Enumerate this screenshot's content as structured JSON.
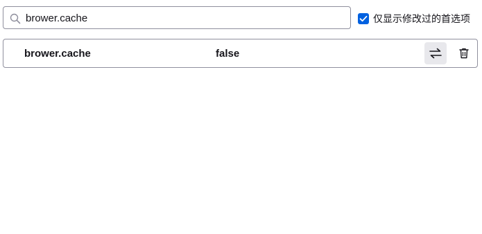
{
  "search": {
    "value": "brower.cache",
    "icon": "search-icon"
  },
  "filter": {
    "show_modified_label": "仅显示修改过的首选项",
    "checked": true,
    "accent_color": "#0061e0"
  },
  "prefs": [
    {
      "name": "brower.cache",
      "value": "false",
      "toggle_icon": "toggle-arrows-icon",
      "delete_icon": "trash-icon"
    }
  ]
}
